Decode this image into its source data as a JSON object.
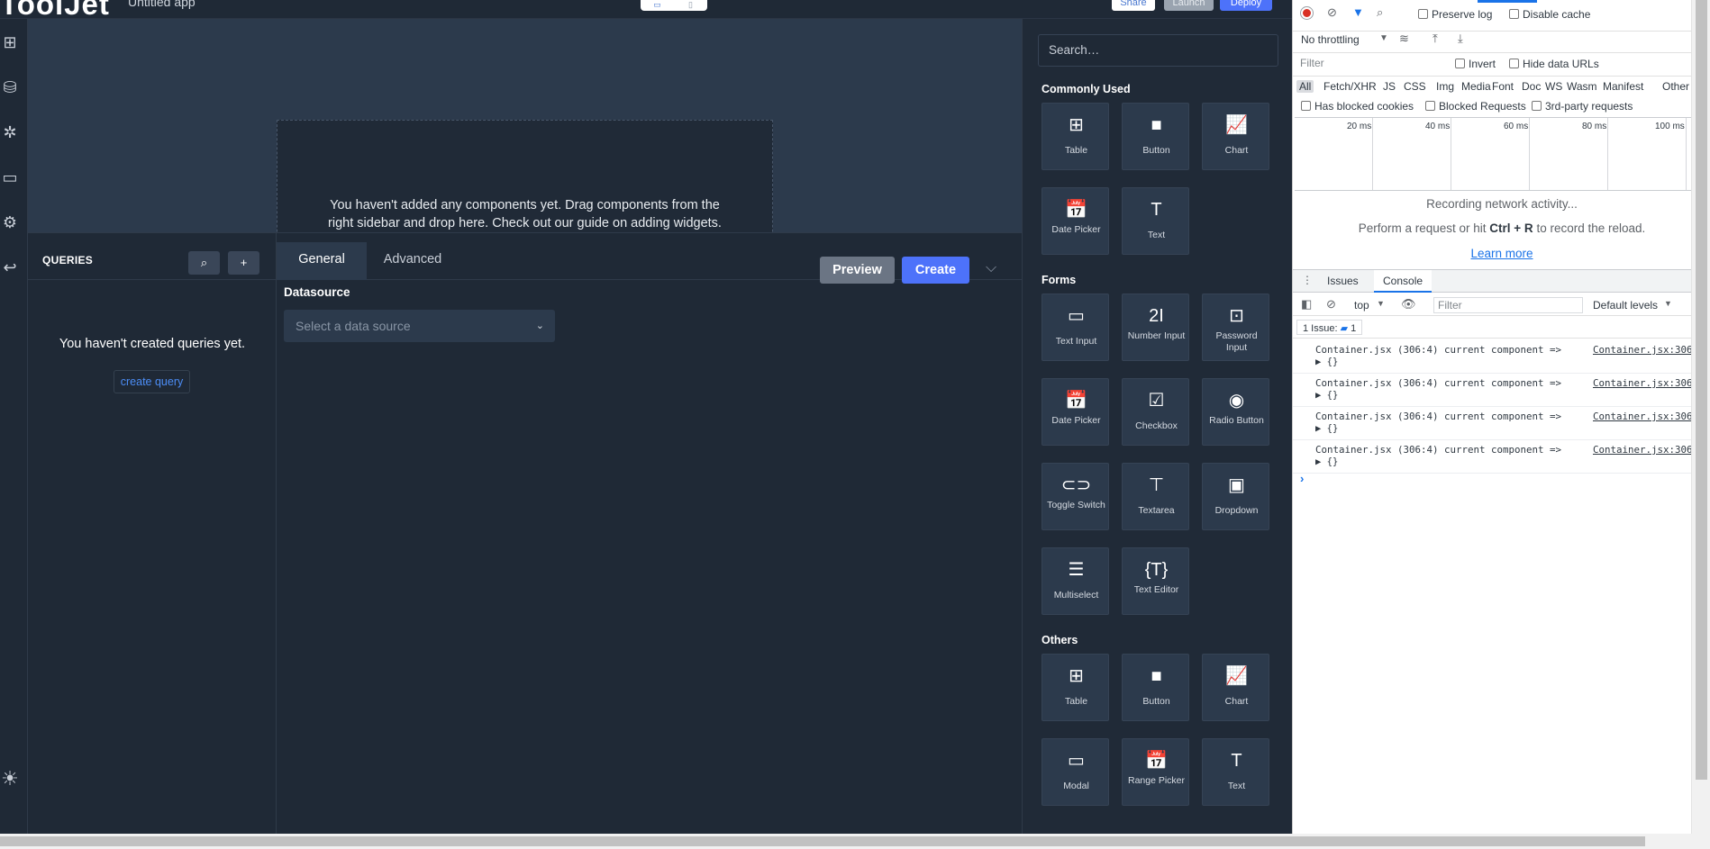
{
  "topbar": {
    "logo": "ToolJet",
    "app_name": "Untitled app",
    "view_desktop": "▭",
    "view_mobile": "▯",
    "share": "Share",
    "launch": "Launch",
    "deploy": "Deploy"
  },
  "rail": {
    "inspector": "⊞",
    "database": "⛁",
    "debugger": "✲",
    "comments": "▭",
    "settings": "⚙",
    "back": "↩",
    "theme": "☀"
  },
  "canvas": {
    "empty_line1": "You haven't added any components yet. Drag components from the",
    "empty_line2": "right sidebar and drop here. Check out our guide on adding widgets."
  },
  "queries": {
    "title": "QUERIES",
    "search_icon": "⌕",
    "add_icon": "+",
    "empty_text": "You haven't created queries yet.",
    "create_label": "create query"
  },
  "editor": {
    "tab_general": "General",
    "tab_advanced": "Advanced",
    "preview": "Preview",
    "create": "Create",
    "chevron": "⌵",
    "datasource_label": "Datasource",
    "datasource_placeholder": "Select a data source",
    "datasource_caret": "⌄"
  },
  "widgets": {
    "search_placeholder": "Search…",
    "sections": {
      "common": "Commonly Used",
      "forms": "Forms",
      "others": "Others"
    },
    "common": [
      {
        "label": "Table",
        "icon": "⊞"
      },
      {
        "label": "Button",
        "icon": "■"
      },
      {
        "label": "Chart",
        "icon": "📈"
      },
      {
        "label": "Date Picker",
        "icon": "📅"
      },
      {
        "label": "Text",
        "icon": "T"
      }
    ],
    "forms": [
      {
        "label": "Text Input",
        "icon": "▭"
      },
      {
        "label": "Number Input",
        "icon": "2I"
      },
      {
        "label": "Password Input",
        "icon": "⊡"
      },
      {
        "label": "Date Picker",
        "icon": "📅"
      },
      {
        "label": "Checkbox",
        "icon": "☑"
      },
      {
        "label": "Radio Button",
        "icon": "◉"
      },
      {
        "label": "Toggle Switch",
        "icon": "⊂⊃"
      },
      {
        "label": "Textarea",
        "icon": "⊤"
      },
      {
        "label": "Dropdown",
        "icon": "▣"
      },
      {
        "label": "Multiselect",
        "icon": "☰"
      },
      {
        "label": "Text Editor",
        "icon": "{T}"
      }
    ],
    "others": [
      {
        "label": "Table",
        "icon": "⊞"
      },
      {
        "label": "Button",
        "icon": "■"
      },
      {
        "label": "Chart",
        "icon": "📈"
      },
      {
        "label": "Modal",
        "icon": "▭"
      },
      {
        "label": "Range Picker",
        "icon": "📅"
      },
      {
        "label": "Text",
        "icon": "T"
      }
    ]
  },
  "devtools": {
    "preserve_log": "Preserve log",
    "disable_cache": "Disable cache",
    "throttling": "No throttling",
    "filter_placeholder": "Filter",
    "invert": "Invert",
    "hide_data_urls": "Hide data URLs",
    "types": [
      "All",
      "Fetch/XHR",
      "JS",
      "CSS",
      "Img",
      "Media",
      "Font",
      "Doc",
      "WS",
      "Wasm",
      "Manifest",
      "Other"
    ],
    "has_blocked_cookies": "Has blocked cookies",
    "blocked_requests": "Blocked Requests",
    "third_party": "3rd-party requests",
    "timeline_labels": [
      "20 ms",
      "40 ms",
      "60 ms",
      "80 ms",
      "100 ms"
    ],
    "recording": "Recording network activity...",
    "perform_pre": "Perform a request or hit ",
    "perform_key": "Ctrl + R",
    "perform_post": " to record the reload.",
    "learn_more": "Learn more",
    "tab_issues": "Issues",
    "tab_console": "Console",
    "context": "top",
    "console_filter": "Filter",
    "levels": "Default levels",
    "issues_badge": "1 Issue:",
    "issues_count": "1",
    "logs": [
      {
        "msg": "Container.jsx (306:4) current component =>",
        "obj": "▶ {}",
        "src": "Container.jsx:306"
      },
      {
        "msg": "Container.jsx (306:4) current component =>",
        "obj": "▶ {}",
        "src": "Container.jsx:306"
      },
      {
        "msg": "Container.jsx (306:4) current component =>",
        "obj": "▶ {}",
        "src": "Container.jsx:306"
      },
      {
        "msg": "Container.jsx (306:4) current component =>",
        "obj": "▶ {}",
        "src": "Container.jsx:306"
      }
    ],
    "prompt": "›"
  }
}
